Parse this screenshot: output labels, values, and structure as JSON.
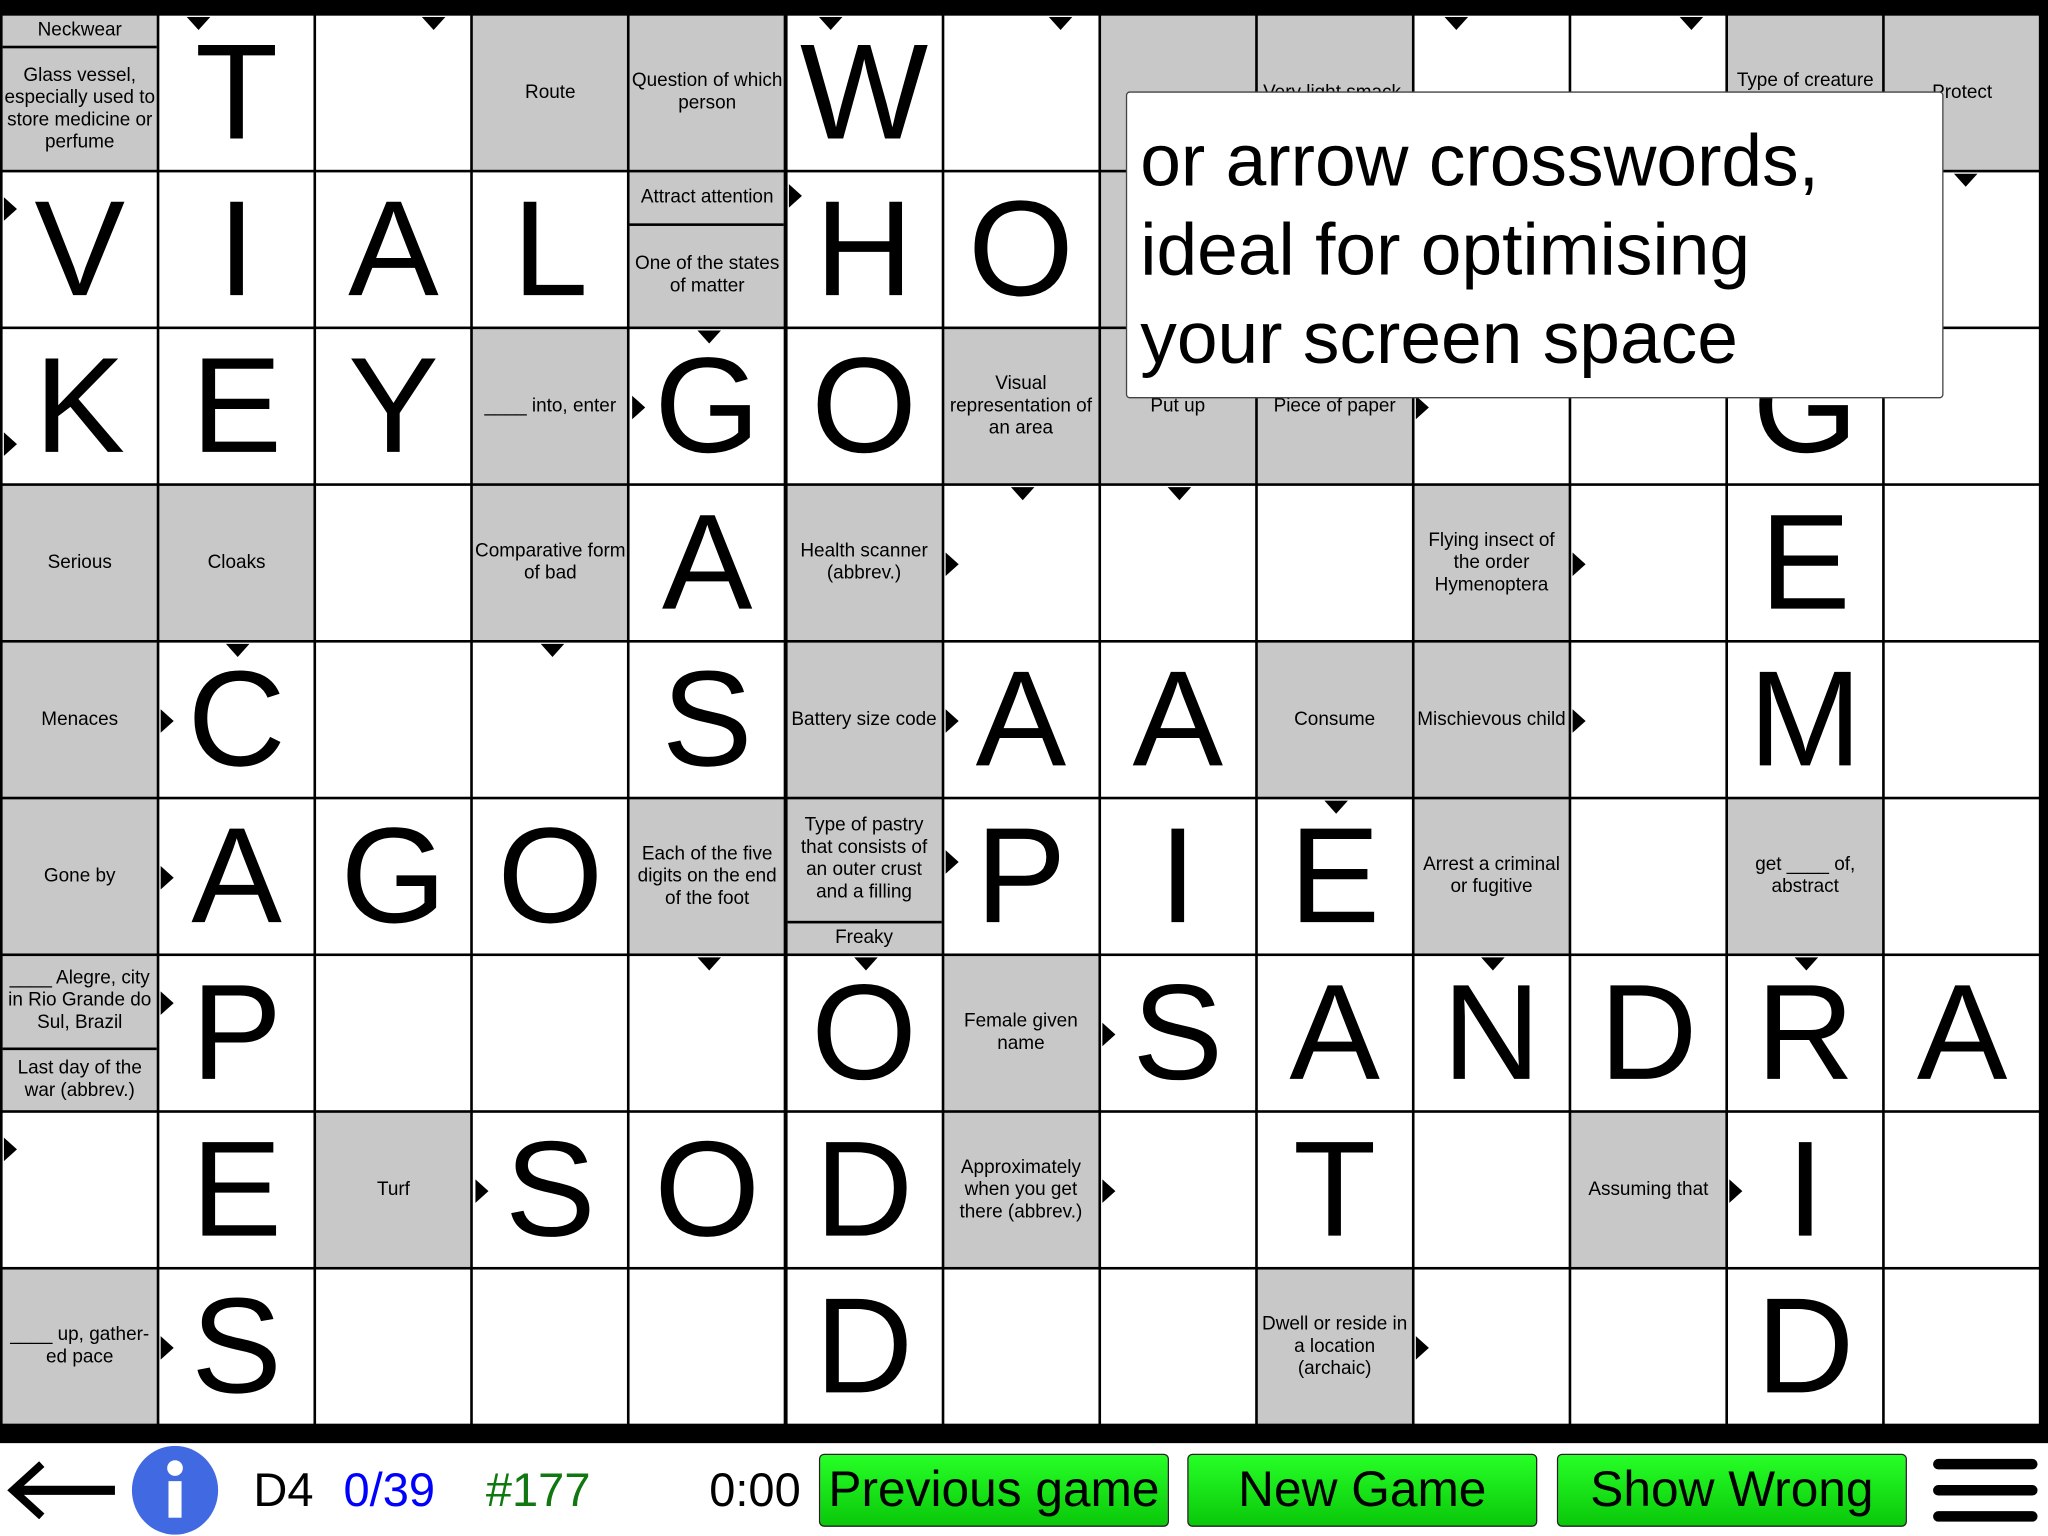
{
  "grid": {
    "rows": [
      [
        {
          "t": "S",
          "clues": [
            "Neckwear",
            "Glass vessel, especially used to store medicine or perfume"
          ]
        },
        {
          "t": "L",
          "v": "T"
        },
        {
          "t": "W"
        },
        {
          "t": "C",
          "clues": [
            "Route"
          ]
        },
        {
          "t": "C",
          "clues": [
            "Question of which person"
          ]
        },
        {
          "t": "L",
          "v": "W"
        },
        {
          "t": "W"
        },
        {
          "t": "C",
          "clues": [
            ""
          ]
        },
        {
          "t": "C",
          "clues": [
            "Very light smack,"
          ]
        },
        {
          "t": "W"
        },
        {
          "t": "W"
        },
        {
          "t": "C",
          "clues": [
            "Type of creature sometimes"
          ]
        },
        {
          "t": "C",
          "clues": [
            "Protect"
          ]
        }
      ],
      [
        {
          "t": "L",
          "v": "V"
        },
        {
          "t": "L",
          "v": "I"
        },
        {
          "t": "L",
          "v": "A"
        },
        {
          "t": "L",
          "v": "L"
        },
        {
          "t": "S",
          "clues": [
            "Attract attention",
            "One of the states of matter"
          ]
        },
        {
          "t": "L",
          "v": "H"
        },
        {
          "t": "L",
          "v": "O"
        },
        {
          "t": "C",
          "clues": [
            ""
          ]
        },
        {
          "t": "W"
        },
        {
          "t": "W"
        },
        {
          "t": "W"
        },
        {
          "t": "W"
        },
        {
          "t": "W"
        }
      ],
      [
        {
          "t": "L",
          "v": "K"
        },
        {
          "t": "L",
          "v": "E"
        },
        {
          "t": "L",
          "v": "Y"
        },
        {
          "t": "C",
          "clues": [
            "____ into, enter"
          ]
        },
        {
          "t": "L",
          "v": "G"
        },
        {
          "t": "L",
          "v": "O"
        },
        {
          "t": "C",
          "clues": [
            "Visual representation of an area"
          ]
        },
        {
          "t": "C",
          "clues": [
            "Put up"
          ]
        },
        {
          "t": "C",
          "clues": [
            "Piece of paper"
          ]
        },
        {
          "t": "W"
        },
        {
          "t": "W"
        },
        {
          "t": "L",
          "v": "G"
        },
        {
          "t": "W"
        }
      ],
      [
        {
          "t": "C",
          "clues": [
            "Serious"
          ]
        },
        {
          "t": "C",
          "clues": [
            "Cloaks"
          ]
        },
        {
          "t": "W"
        },
        {
          "t": "C",
          "clues": [
            "Comparative form of bad"
          ]
        },
        {
          "t": "L",
          "v": "A"
        },
        {
          "t": "C",
          "clues": [
            "Health scanner (abbrev.)"
          ]
        },
        {
          "t": "W"
        },
        {
          "t": "W"
        },
        {
          "t": "W"
        },
        {
          "t": "C",
          "clues": [
            "Flying insect of the order Hymenoptera"
          ]
        },
        {
          "t": "W"
        },
        {
          "t": "L",
          "v": "E"
        },
        {
          "t": "W"
        }
      ],
      [
        {
          "t": "C",
          "clues": [
            "Menaces"
          ]
        },
        {
          "t": "L",
          "v": "C"
        },
        {
          "t": "W"
        },
        {
          "t": "W"
        },
        {
          "t": "L",
          "v": "S"
        },
        {
          "t": "C",
          "clues": [
            "Battery size code"
          ]
        },
        {
          "t": "L",
          "v": "A"
        },
        {
          "t": "L",
          "v": "A"
        },
        {
          "t": "C",
          "clues": [
            "Consume"
          ]
        },
        {
          "t": "C",
          "clues": [
            "Mischievous child"
          ]
        },
        {
          "t": "W"
        },
        {
          "t": "L",
          "v": "M"
        },
        {
          "t": "W"
        }
      ],
      [
        {
          "t": "C",
          "clues": [
            "Gone by"
          ]
        },
        {
          "t": "L",
          "v": "A"
        },
        {
          "t": "L",
          "v": "G"
        },
        {
          "t": "L",
          "v": "O"
        },
        {
          "t": "C",
          "clues": [
            "Each of the five digits on the end of the foot"
          ]
        },
        {
          "t": "S",
          "clues": [
            "Type of pastry that consists of an outer crust and a filling",
            "Freaky"
          ]
        },
        {
          "t": "L",
          "v": "P"
        },
        {
          "t": "L",
          "v": "I"
        },
        {
          "t": "L",
          "v": "E"
        },
        {
          "t": "C",
          "clues": [
            "Arrest a criminal or fugitive"
          ]
        },
        {
          "t": "W"
        },
        {
          "t": "C",
          "clues": [
            "get ____ of, abstract"
          ]
        },
        {
          "t": "W"
        }
      ],
      [
        {
          "t": "S",
          "clues": [
            "____ Alegre, city in Rio Grande do Sul, Brazil",
            "Last day of the war (abbrev.)"
          ]
        },
        {
          "t": "L",
          "v": "P"
        },
        {
          "t": "W"
        },
        {
          "t": "W"
        },
        {
          "t": "W"
        },
        {
          "t": "L",
          "v": "O"
        },
        {
          "t": "C",
          "clues": [
            "Female given name"
          ]
        },
        {
          "t": "L",
          "v": "S"
        },
        {
          "t": "L",
          "v": "A"
        },
        {
          "t": "L",
          "v": "N"
        },
        {
          "t": "L",
          "v": "D"
        },
        {
          "t": "L",
          "v": "R"
        },
        {
          "t": "L",
          "v": "A"
        }
      ],
      [
        {
          "t": "W"
        },
        {
          "t": "L",
          "v": "E"
        },
        {
          "t": "C",
          "clues": [
            "Turf"
          ]
        },
        {
          "t": "L",
          "v": "S"
        },
        {
          "t": "L",
          "v": "O"
        },
        {
          "t": "L",
          "v": "D"
        },
        {
          "t": "C",
          "clues": [
            "Approximately when you get there (abbrev.)"
          ]
        },
        {
          "t": "W"
        },
        {
          "t": "L",
          "v": "T"
        },
        {
          "t": "W"
        },
        {
          "t": "C",
          "clues": [
            "Assuming that"
          ]
        },
        {
          "t": "L",
          "v": "I"
        },
        {
          "t": "W"
        }
      ],
      [
        {
          "t": "C",
          "clues": [
            "____ up, gather-ed pace"
          ]
        },
        {
          "t": "L",
          "v": "S"
        },
        {
          "t": "W"
        },
        {
          "t": "W"
        },
        {
          "t": "W"
        },
        {
          "t": "L",
          "v": "D"
        },
        {
          "t": "W"
        },
        {
          "t": "W"
        },
        {
          "t": "C",
          "clues": [
            "Dwell or reside in a location (archaic)"
          ]
        },
        {
          "t": "W"
        },
        {
          "t": "W"
        },
        {
          "t": "L",
          "v": "D"
        },
        {
          "t": "W"
        }
      ]
    ]
  },
  "popup": {
    "lines": [
      "or arrow crosswords,",
      "ideal for optimising",
      "your screen space"
    ]
  },
  "bottom_bar": {
    "back_icon": "left-arrow-icon",
    "info_icon": "info-icon",
    "info_color": "#4169e1",
    "clue_id": "D4",
    "progress": "0/39",
    "progress_color": "#0000ff",
    "game_number": "#177",
    "game_number_color": "#117711",
    "timer": "0:00",
    "previous_label": "Previous game",
    "new_label": "New Game",
    "show_wrong_label": "Show Wrong",
    "menu_icon": "hamburger-menu-icon",
    "button_color": "#1ee61e"
  }
}
